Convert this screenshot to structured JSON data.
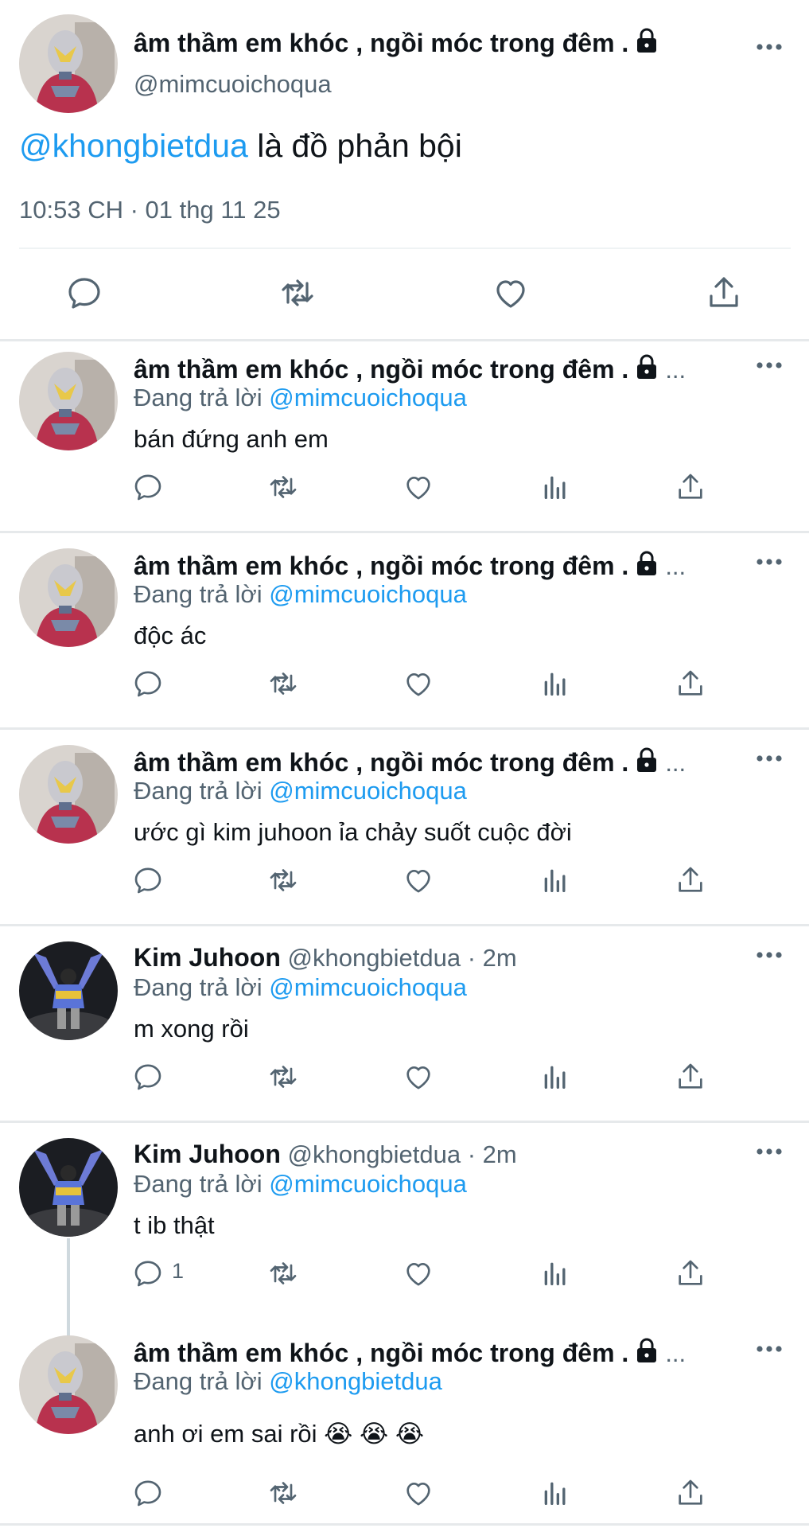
{
  "main_tweet": {
    "display_name": "âm thầm em khóc , ngồi móc trong đêm .",
    "handle": "@mimcuoichoqua",
    "mention": "@khongbietdua",
    "text": " là đồ phản bội",
    "timestamp": "10:53 CH · 01 thg 11 25"
  },
  "replies": [
    {
      "display_name": "âm thầm em khóc , ngồi móc trong đêm .",
      "ellipsis": "...",
      "replying_label": "Đang trả lời",
      "replying_to": "@mimcuoichoqua",
      "text": "bán đứng anh em"
    },
    {
      "display_name": "âm thầm em khóc , ngồi móc trong đêm .",
      "ellipsis": "...",
      "replying_label": "Đang trả lời",
      "replying_to": "@mimcuoichoqua",
      "text": "độc ác"
    },
    {
      "display_name": "âm thầm em khóc , ngồi móc trong đêm .",
      "ellipsis": "...",
      "replying_label": "Đang trả lời",
      "replying_to": "@mimcuoichoqua",
      "text": "ước gì kim juhoon ỉa chảy suốt cuộc đời"
    },
    {
      "display_name": "Kim Juhoon",
      "handle_time": "@khongbietdua · 2m",
      "replying_label": "Đang trả lời",
      "replying_to": "@mimcuoichoqua",
      "text": "m xong rồi"
    },
    {
      "display_name": "Kim Juhoon",
      "handle_time": "@khongbietdua · 2m",
      "replying_label": "Đang trả lời",
      "replying_to": "@mimcuoichoqua",
      "text": "t ib thật",
      "reply_count": "1"
    },
    {
      "display_name": "âm thầm em khóc , ngồi móc trong đêm .",
      "ellipsis": "...",
      "replying_label": "Đang trả lời",
      "replying_to": "@khongbietdua",
      "text": "anh ơi em sai rồi 😭 😭 😭"
    }
  ],
  "colors": {
    "accent": "#1d9bf0",
    "muted": "#536471",
    "text": "#0f1419"
  }
}
